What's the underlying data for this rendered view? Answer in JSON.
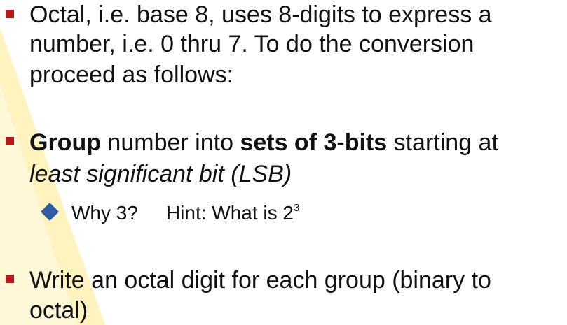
{
  "bullets": {
    "b1": {
      "line1": "Octal, i.e. base 8, uses 8-digits to express a",
      "line2": "number, i.e. 0 thru 7. To do the conversion",
      "line3": "proceed as follows:"
    },
    "b2": {
      "bold1": "Group",
      "text1": " number into ",
      "bold2": "sets of 3-bits",
      "text2": " starting at",
      "italic_line": "least significant bit (LSB)"
    },
    "sub": {
      "question": "Why 3?",
      "hint_prefix": "Hint: What is 2",
      "hint_exponent": "3"
    },
    "b3": {
      "line1": "Write an octal digit for each group (binary to",
      "line2": "octal)"
    }
  },
  "colors": {
    "bullet": "#b31b1b",
    "diamond": "#2f5aa8",
    "wedge": "#fff6c8"
  }
}
